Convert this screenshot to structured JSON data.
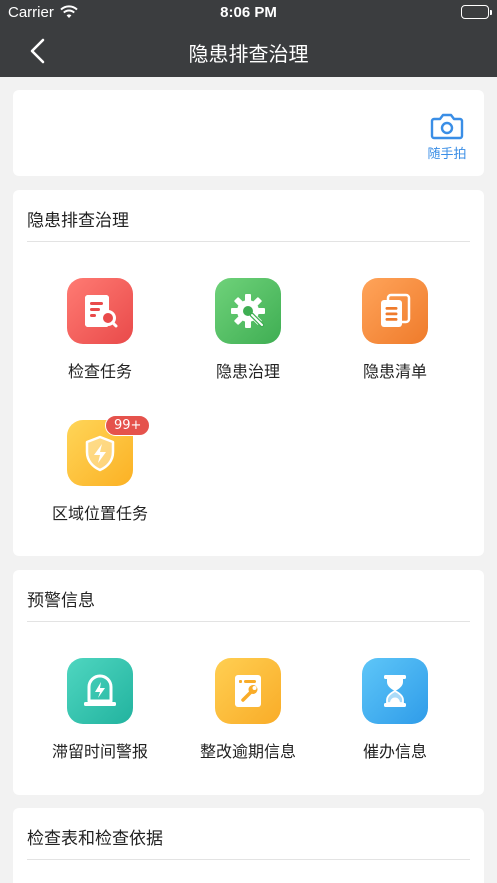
{
  "status_bar": {
    "carrier": "Carrier",
    "time": "8:06 PM"
  },
  "nav": {
    "title": "隐患排查治理"
  },
  "quick_action": {
    "label": "随手拍",
    "icon": "camera-icon"
  },
  "sections": [
    {
      "title": "隐患排查治理",
      "items": [
        {
          "label": "检查任务",
          "icon": "inspection-document-icon",
          "color": "#e94a4a"
        },
        {
          "label": "隐患治理",
          "icon": "gear-wrench-icon",
          "color": "#3fae53"
        },
        {
          "label": "隐患清单",
          "icon": "list-stack-icon",
          "color": "#ef7b2b"
        },
        {
          "label": "区域位置任务",
          "icon": "shield-lightning-icon",
          "color": "#fbb124",
          "badge": "99+"
        }
      ]
    },
    {
      "title": "预警信息",
      "items": [
        {
          "label": "滞留时间警报",
          "icon": "alarm-light-icon",
          "color": "#22b39f"
        },
        {
          "label": "整改逾期信息",
          "icon": "repair-document-icon",
          "color": "#f9ac28"
        },
        {
          "label": "催办信息",
          "icon": "hourglass-icon",
          "color": "#2f9ce9"
        }
      ]
    },
    {
      "title": "检查表和检查依据",
      "items": []
    }
  ]
}
